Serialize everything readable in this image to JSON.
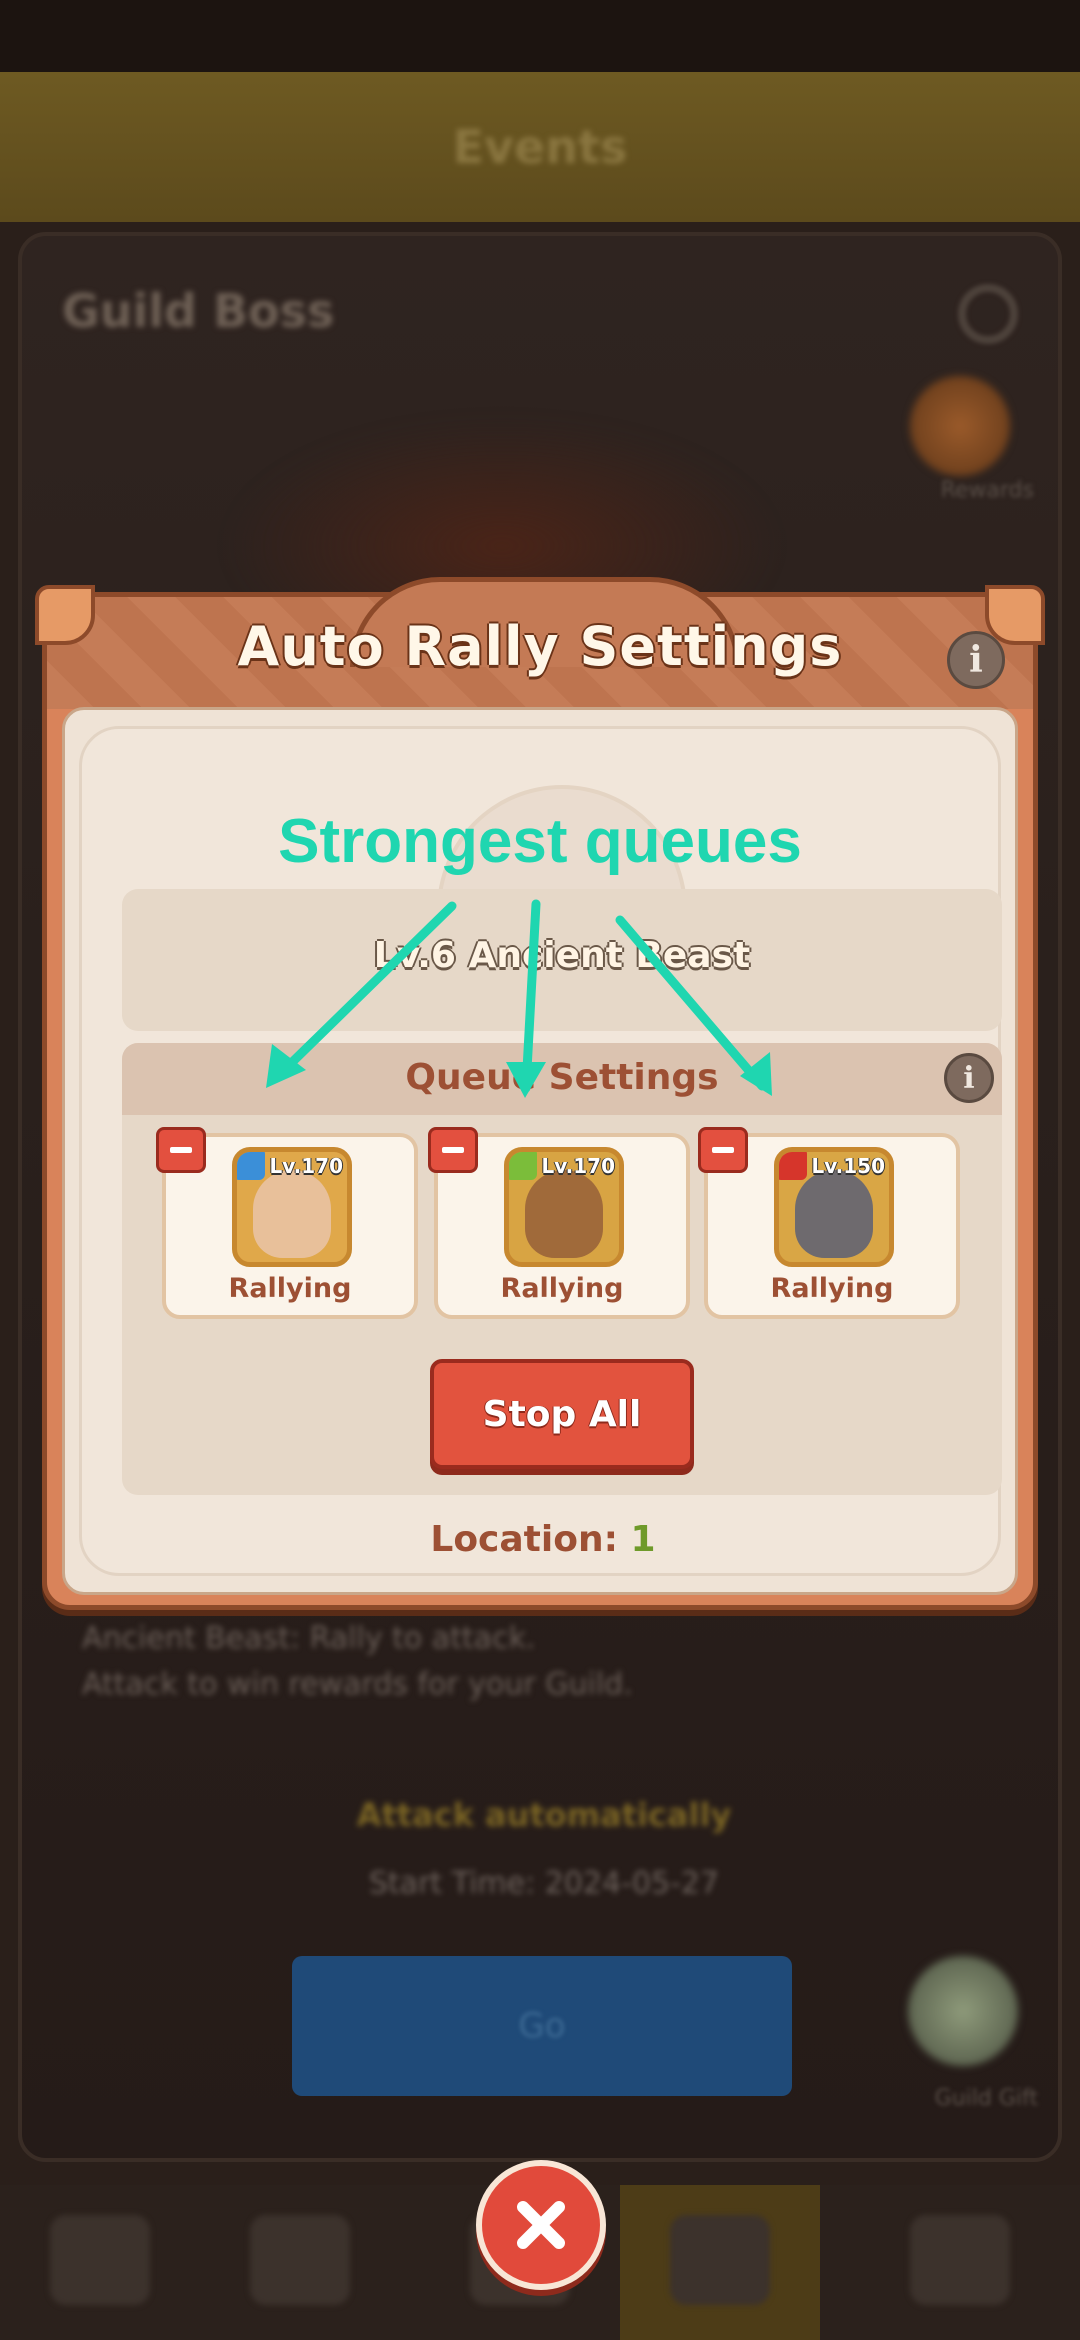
{
  "background": {
    "header_title": "Events",
    "panel_title": "Guild Boss",
    "reward_label": "Rewards",
    "description_lines": [
      "Ancient Beast: Rally to attack.",
      "Attack to win rewards for your Guild."
    ],
    "auto_rally_text": "Attack automatically",
    "time_text": "Start Time: 2024-05-27",
    "go_button_label": "Go",
    "egg_label": "Guild Gift"
  },
  "modal": {
    "title": "Auto Rally Settings",
    "info_icon": "i",
    "beast_name": "Lv.6 Ancient Beast",
    "queue_settings_title": "Queue Settings",
    "queues": [
      {
        "level": "Lv.170",
        "status": "Rallying",
        "portrait": "soldier-hero-icon",
        "badge_color": "#3b8fd8",
        "face_color": "#e8c09a",
        "bg_color": "#e0a84a"
      },
      {
        "level": "Lv.170",
        "status": "Rallying",
        "portrait": "tree-creature-icon",
        "badge_color": "#7bbd3a",
        "face_color": "#a06a3a",
        "bg_color": "#d8a443"
      },
      {
        "level": "Lv.150",
        "status": "Rallying",
        "portrait": "boar-beast-icon",
        "badge_color": "#d6352b",
        "face_color": "#6e6a6e",
        "bg_color": "#d9a645"
      }
    ],
    "stop_all_label": "Stop All",
    "location_label": "Location:",
    "location_value": "1"
  },
  "annotation": {
    "text": "Strongest queues",
    "color": "#1fd6b0"
  },
  "close_icon": "close-icon",
  "colors": {
    "modal_frame": "#d9835a",
    "stop_button": "#e2533e",
    "accent_text": "#9d5034",
    "location_value": "#6f9a2a"
  }
}
